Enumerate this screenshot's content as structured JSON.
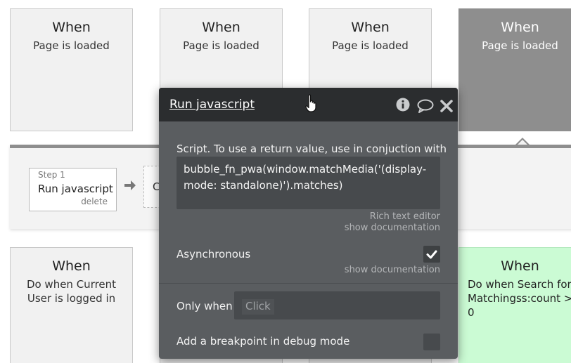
{
  "events_top": [
    {
      "title": "When",
      "subtitle": "Page is loaded"
    },
    {
      "title": "When",
      "subtitle": "Page is loaded"
    },
    {
      "title": "When",
      "subtitle": "Page is loaded"
    },
    {
      "title": "When",
      "subtitle": "Page is loaded"
    }
  ],
  "events_bottom": [
    {
      "title": "When",
      "subtitle": "Do when Current User is logged in"
    },
    {
      "title": "When",
      "subtitle": "Do when Search for Matchingss:count > 0"
    }
  ],
  "workflow": {
    "step1": {
      "number": "Step 1",
      "name": "Run javascript",
      "delete": "delete"
    },
    "step2_partial": "C"
  },
  "panel": {
    "title": "Run javascript",
    "script_label": "Script. To use a return value, use in conjuction with",
    "script_value_line1": "bubble_fn_pwa(window.matchMedia('(display-",
    "script_value_line2": "mode: standalone)').matches)",
    "rich_text_editor": "Rich text editor",
    "show_documentation": "show documentation",
    "asynchronous_label": "Asynchronous",
    "asynchronous_checked": true,
    "show_documentation_2": "show documentation",
    "only_when_label": "Only when",
    "only_when_placeholder": "Click",
    "breakpoint_label": "Add a breakpoint in debug mode",
    "breakpoint_checked": false
  },
  "colors": {
    "panel_bg": "#5a5d60",
    "panel_header": "#2b2d2f",
    "selected_event": "#8e8e8e",
    "conditional_event": "#cbfbd4"
  },
  "icons": [
    "info-icon",
    "comment-icon",
    "close-icon",
    "arrow-right-icon",
    "checkmark-icon",
    "hand-cursor-icon"
  ]
}
